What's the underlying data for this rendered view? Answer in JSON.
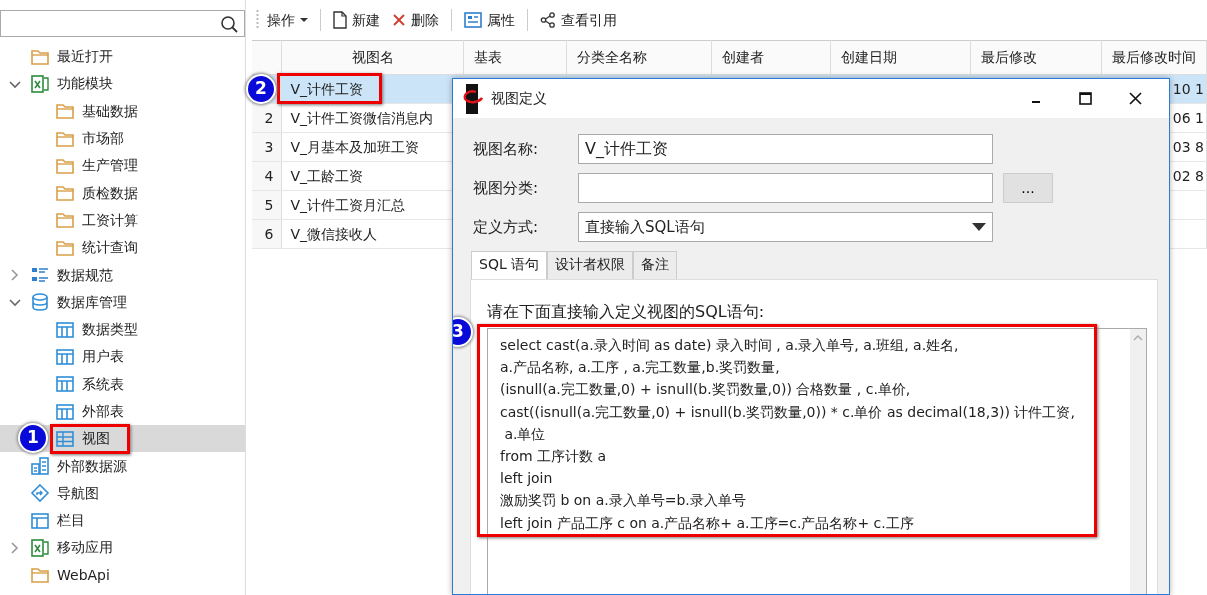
{
  "toolbar": [
    {
      "label": "操作",
      "kind": "menu",
      "separator_before": false
    },
    {
      "label": "新建",
      "kind": "new",
      "separator_before": true
    },
    {
      "label": "删除",
      "kind": "delete",
      "separator_before": false
    },
    {
      "label": "属性",
      "kind": "properties",
      "separator_before": true
    },
    {
      "label": "查看引用",
      "kind": "share",
      "separator_before": true
    }
  ],
  "sidebar": {
    "tree": [
      {
        "label": "最近打开",
        "kind": "folder",
        "selected": false
      },
      {
        "label": "功能模块",
        "kind": "excel",
        "selected": false,
        "expanded": true,
        "children": [
          {
            "label": "基础数据",
            "kind": "folder",
            "selected": false
          },
          {
            "label": "市场部",
            "kind": "folder",
            "selected": false
          },
          {
            "label": "生产管理",
            "kind": "folder",
            "selected": false
          },
          {
            "label": "质检数据",
            "kind": "folder",
            "selected": false
          },
          {
            "label": "工资计算",
            "kind": "folder",
            "selected": false
          },
          {
            "label": "统计查询",
            "kind": "folder",
            "selected": false
          }
        ]
      },
      {
        "label": "数据规范",
        "kind": "list",
        "selected": false,
        "expanded": false
      },
      {
        "label": "数据库管理",
        "kind": "database",
        "selected": false,
        "expanded": true,
        "children": [
          {
            "label": "数据类型",
            "kind": "table",
            "selected": false
          },
          {
            "label": "用户表",
            "kind": "table",
            "selected": false
          },
          {
            "label": "系统表",
            "kind": "table",
            "selected": false
          },
          {
            "label": "外部表",
            "kind": "table",
            "selected": false
          },
          {
            "label": "视图",
            "kind": "view",
            "selected": true,
            "callout": "1"
          }
        ]
      },
      {
        "label": "外部数据源",
        "kind": "datasource",
        "selected": false
      },
      {
        "label": "导航图",
        "kind": "navigation",
        "selected": false
      },
      {
        "label": "栏目",
        "kind": "column",
        "selected": false
      },
      {
        "label": "移动应用",
        "kind": "excel",
        "selected": false,
        "expanded": false
      },
      {
        "label": "WebApi",
        "kind": "folder",
        "selected": false
      }
    ]
  },
  "table": {
    "columns": [
      "视图名",
      "基表",
      "分类全名称",
      "创建者",
      "创建日期",
      "最后修改",
      "最后修改时间"
    ],
    "rows": [
      {
        "name": "V_计件工资",
        "selected": true,
        "callout": "2",
        "last_modified_time": "10 1"
      },
      {
        "number": "2",
        "name": "V_计件工资微信消息内",
        "selected": false,
        "last_modified_time": "06 1"
      },
      {
        "number": "3",
        "name": "V_月基本及加班工资",
        "selected": false,
        "last_modified_time": "03 8"
      },
      {
        "number": "4",
        "name": "V_工龄工资",
        "selected": false,
        "last_modified_time": "02 8"
      },
      {
        "number": "5",
        "name": "V_计件工资月汇总",
        "selected": false
      },
      {
        "number": "6",
        "name": "V_微信接收人",
        "selected": false
      }
    ]
  },
  "dialog": {
    "title": "视图定义",
    "fields": [
      {
        "label": "视图名称:",
        "kind": "text",
        "value": "V_计件工资"
      },
      {
        "label": "视图分类:",
        "kind": "browse",
        "button": "..."
      },
      {
        "label": "定义方式:",
        "kind": "select",
        "value": "直接输入SQL语句"
      }
    ],
    "tabs": [
      {
        "label": "SQL 语句",
        "selected": true
      },
      {
        "label": "设计者权限",
        "selected": false
      },
      {
        "label": "备注",
        "selected": false
      }
    ],
    "instruction": "请在下面直接输入定义视图的SQL语句:",
    "sql": {
      "callout": "3",
      "lines": [
        "select cast(a.录入时间 as date) 录入时间 , a.录入单号, a.班组, a.姓名,",
        "a.产品名称, a.工序 , a.完工数量,b.奖罚数量,",
        "(isnull(a.完工数量,0) + isnull(b.奖罚数量,0)) 合格数量 , c.单价,",
        "cast((isnull(a.完工数量,0) + isnull(b.奖罚数量,0)) * c.单价 as decimal(18,3)) 计件工资,",
        " a.单位",
        "from 工序计数 a",
        "left join",
        "激励奖罚 b on a.录入单号=b.录入单号",
        "left join 产品工序 c on a.产品名称+ a.工序=c.产品名称+ c.工序"
      ]
    }
  }
}
